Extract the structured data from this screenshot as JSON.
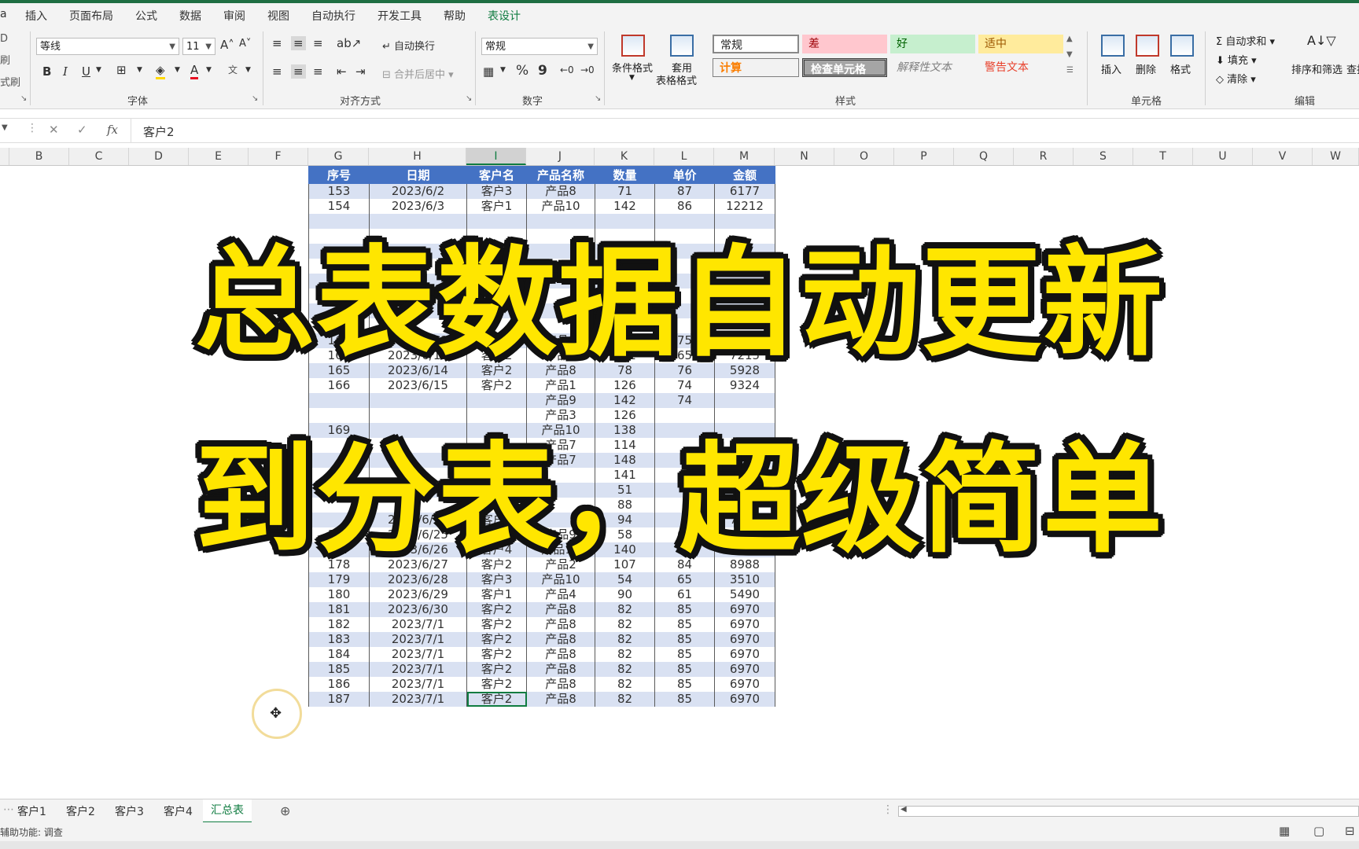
{
  "ribbon_tabs": [
    "插入",
    "页面布局",
    "公式",
    "数据",
    "审阅",
    "视图",
    "自动执行",
    "开发工具",
    "帮助",
    "表设计"
  ],
  "ribbon_tab_partial": "a",
  "left_clip": [
    "D",
    "刷",
    "式刷"
  ],
  "font_group": {
    "font_name": "等线",
    "font_size": "11",
    "grow": "A˄",
    "shrink": "A˅",
    "bold": "B",
    "italic": "I",
    "underline": "U",
    "name": "字体"
  },
  "align_group": {
    "wrap": "自动换行",
    "merge": "合并后居中",
    "name": "对齐方式"
  },
  "number_group": {
    "format": "常规",
    "percent": "%",
    "comma": "9",
    "name": "数字"
  },
  "styles_group": {
    "cond_format": "条件格式",
    "table_format_1": "套用",
    "table_format_2": "表格格式",
    "normal": "常规",
    "bad": "差",
    "good": "好",
    "neutral": "适中",
    "calc": "计算",
    "check": "检查单元格",
    "explain": "解释性文本",
    "warning": "警告文本",
    "name": "样式"
  },
  "cells_group": {
    "insert": "插入",
    "delete": "删除",
    "format": "格式",
    "name": "单元格"
  },
  "edit_group": {
    "autosum": "自动求和",
    "fill": "填充",
    "clear": "清除",
    "sort": "排序和筛选",
    "find": "查找",
    "name": "编辑"
  },
  "formula_bar": {
    "value": "客户2"
  },
  "columns": [
    "B",
    "C",
    "D",
    "E",
    "F",
    "G",
    "H",
    "I",
    "J",
    "K",
    "L",
    "M",
    "N",
    "O",
    "P",
    "Q",
    "R",
    "S",
    "T",
    "U",
    "V",
    "W"
  ],
  "table": {
    "headers": [
      "序号",
      "日期",
      "客户名",
      "产品名称",
      "数量",
      "单价",
      "金额"
    ],
    "rows": [
      [
        "153",
        "2023/6/2",
        "客户3",
        "产品8",
        "71",
        "87",
        "6177"
      ],
      [
        "154",
        "2023/6/3",
        "客户1",
        "产品10",
        "142",
        "86",
        "12212"
      ],
      [
        "",
        "",
        "",
        "",
        "",
        "",
        ""
      ],
      [
        "",
        "",
        "",
        "",
        "",
        "",
        ""
      ],
      [
        "",
        "",
        "",
        "",
        "",
        "",
        ""
      ],
      [
        "",
        "",
        "",
        "",
        "",
        "",
        ""
      ],
      [
        "",
        "",
        "",
        "",
        "",
        "",
        ""
      ],
      [
        "",
        "",
        "",
        "",
        "",
        "",
        ""
      ],
      [
        "",
        "",
        "",
        "",
        "",
        "",
        ""
      ],
      [
        "",
        "",
        "",
        "",
        "",
        "",
        ""
      ],
      [
        "163",
        "2023/6/12",
        "客户3",
        "产品3",
        "124",
        "75",
        "9300"
      ],
      [
        "164",
        "2023/6/13",
        "客户2",
        "产品4",
        "111",
        "65",
        "7215"
      ],
      [
        "165",
        "2023/6/14",
        "客户2",
        "产品8",
        "78",
        "76",
        "5928"
      ],
      [
        "166",
        "2023/6/15",
        "客户2",
        "产品1",
        "126",
        "74",
        "9324"
      ],
      [
        "",
        "",
        "",
        "产品9",
        "142",
        "74",
        ""
      ],
      [
        "",
        "",
        "",
        "产品3",
        "126",
        "",
        ""
      ],
      [
        "169",
        "",
        "",
        "产品10",
        "138",
        "",
        ""
      ],
      [
        "",
        "",
        "",
        "产品7",
        "114",
        "",
        ""
      ],
      [
        "",
        "",
        "",
        "产品7",
        "148",
        "",
        ""
      ],
      [
        "",
        "",
        "",
        "",
        "141",
        "",
        ""
      ],
      [
        "",
        "",
        "",
        "",
        "51",
        "",
        ""
      ],
      [
        "",
        "",
        "",
        "",
        "88",
        "",
        ""
      ],
      [
        "",
        "2023/6/24",
        "客户3",
        "",
        "94",
        "",
        "7050"
      ],
      [
        "176",
        "2023/6/25",
        "客户2",
        "产品9",
        "58",
        "69",
        "4002"
      ],
      [
        "177",
        "2023/6/26",
        "客户4",
        "产品10",
        "140",
        "68",
        "9520"
      ],
      [
        "178",
        "2023/6/27",
        "客户2",
        "产品2",
        "107",
        "84",
        "8988"
      ],
      [
        "179",
        "2023/6/28",
        "客户3",
        "产品10",
        "54",
        "65",
        "3510"
      ],
      [
        "180",
        "2023/6/29",
        "客户1",
        "产品4",
        "90",
        "61",
        "5490"
      ],
      [
        "181",
        "2023/6/30",
        "客户2",
        "产品8",
        "82",
        "85",
        "6970"
      ],
      [
        "182",
        "2023/7/1",
        "客户2",
        "产品8",
        "82",
        "85",
        "6970"
      ],
      [
        "183",
        "2023/7/1",
        "客户2",
        "产品8",
        "82",
        "85",
        "6970"
      ],
      [
        "184",
        "2023/7/1",
        "客户2",
        "产品8",
        "82",
        "85",
        "6970"
      ],
      [
        "185",
        "2023/7/1",
        "客户2",
        "产品8",
        "82",
        "85",
        "6970"
      ],
      [
        "186",
        "2023/7/1",
        "客户2",
        "产品8",
        "82",
        "85",
        "6970"
      ],
      [
        "187",
        "2023/7/1",
        "客户2",
        "产品8",
        "82",
        "85",
        "6970"
      ]
    ]
  },
  "overlay": {
    "line1": "总表数据自动更新",
    "line2": "到分表，超级简单"
  },
  "sheet_tabs": [
    "客户1",
    "客户2",
    "客户3",
    "客户4",
    "汇总表"
  ],
  "status": {
    "accessibility": "辅助功能: 调查"
  },
  "colors": {
    "accent": "#107c41",
    "header_blue": "#4472c4",
    "band_blue": "#d9e1f2",
    "title_yellow": "#ffe600"
  }
}
